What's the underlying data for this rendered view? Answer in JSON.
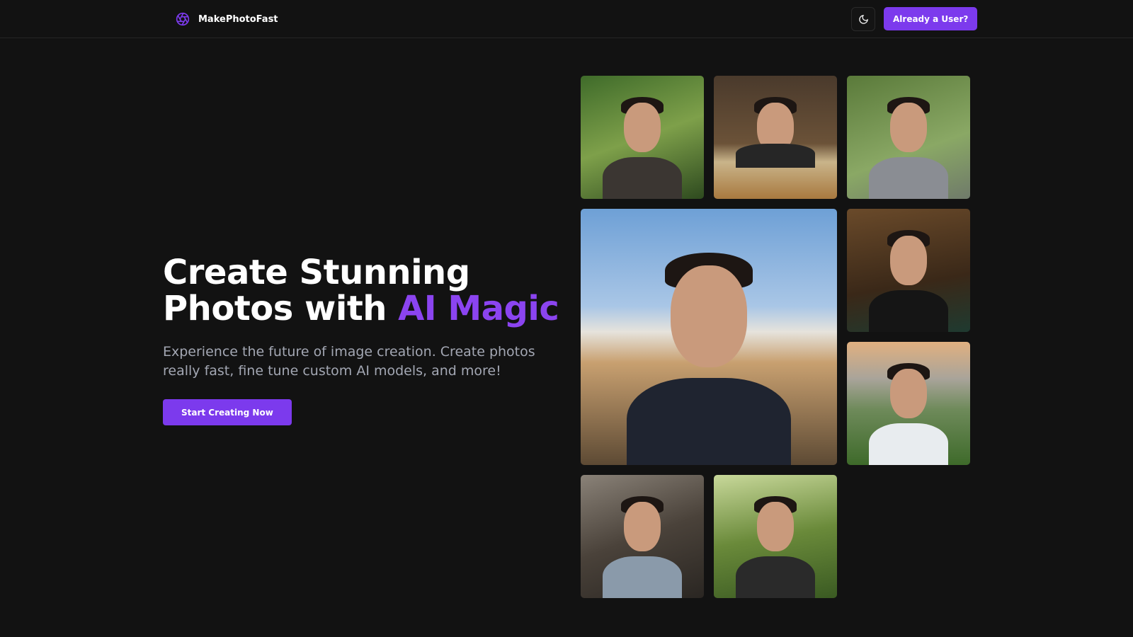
{
  "nav": {
    "brand": "MakePhotoFast",
    "theme_icon": "moon-icon",
    "login_label": "Already a User?"
  },
  "hero": {
    "title_part1": "Create Stunning",
    "title_part2": "Photos with ",
    "title_accent": "AI Magic",
    "subtitle": "Experience the future of image creation. Create photos really fast, fine tune custom AI models, and more!",
    "cta_label": "Start Creating Now"
  },
  "colors": {
    "accent": "#7c3aed",
    "background": "#121212"
  }
}
